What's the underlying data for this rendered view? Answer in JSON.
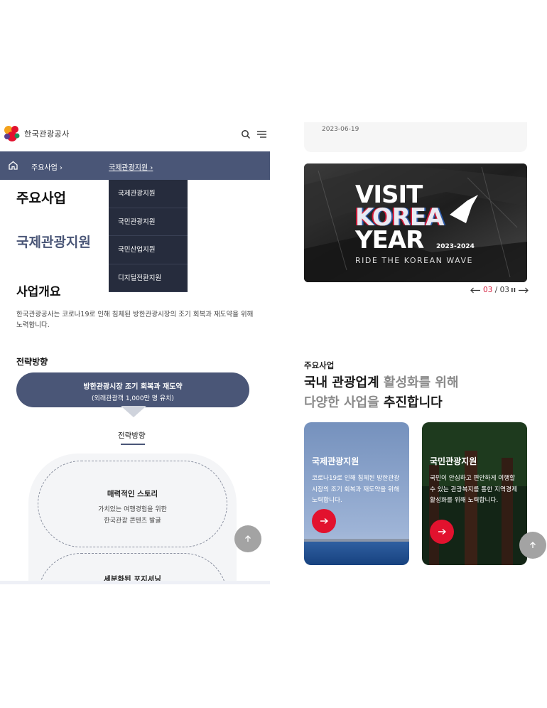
{
  "left": {
    "logo_text": "한국관광공사",
    "nav": {
      "crumb1": "주요사업",
      "crumb2": "국제관광지원"
    },
    "dropdown": [
      "국제관광지원",
      "국민관광지원",
      "국민산업지원",
      "디지털전환지원"
    ],
    "title": "주요사업",
    "subtitle": "국제관광지원",
    "section_title": "사업개요",
    "description": "한국관광공사는 코로나19로 인해 침체된 방한관광시장의 조기 회복과 재도약을 위해 노력합니다.",
    "strategy_heading": "전략방향",
    "goal": {
      "line1": "방한관광시장 조기 회복과 재도약",
      "line2": "(외래관광객 1,000만 명 유치)"
    },
    "strategy_tab": "전략방향",
    "cards": [
      {
        "title": "매력적인 스토리",
        "line1": "가치있는 여행경험을 위한",
        "line2": "한국관광 콘텐츠 발굴"
      },
      {
        "title": "세분화된 포지셔닝"
      }
    ]
  },
  "right": {
    "date": "2023-06-19",
    "banner": {
      "visit": "VISIT",
      "korea": "KOREA",
      "year": "YEAR",
      "years": "2023-2024",
      "tagline": "RIDE THE KOREAN WAVE"
    },
    "pager": {
      "current": "03",
      "sep": " / ",
      "total": "03"
    },
    "section_label": "주요사업",
    "headline": {
      "l1_dark": "국내 관광업계",
      "l1_light": " 활성화를 위해",
      "l2_light": "다양한 사업을",
      "l2_dark": " 추진합니다"
    },
    "programs": [
      {
        "title": "국제관광지원",
        "desc": "코로나19로 인해 침체된 방한관광시장의 조기 회복과 재도약을 위해 노력합니다."
      },
      {
        "title": "국민관광지원",
        "desc": "국민이 안심하고 편안하게 여행할 수 있는 관광복지를 통한 지역경제 활성화를 위해 노력합니다."
      }
    ]
  },
  "colors": {
    "navy": "#4a5677",
    "dropdown": "#262c3d",
    "accent_red": "#e2122e"
  },
  "icons": [
    "logo-icon",
    "search-icon",
    "menu-icon",
    "home-icon",
    "chevron-right-icon",
    "arrow-up-icon",
    "arrow-left-icon",
    "arrow-right-icon",
    "pause-icon"
  ]
}
